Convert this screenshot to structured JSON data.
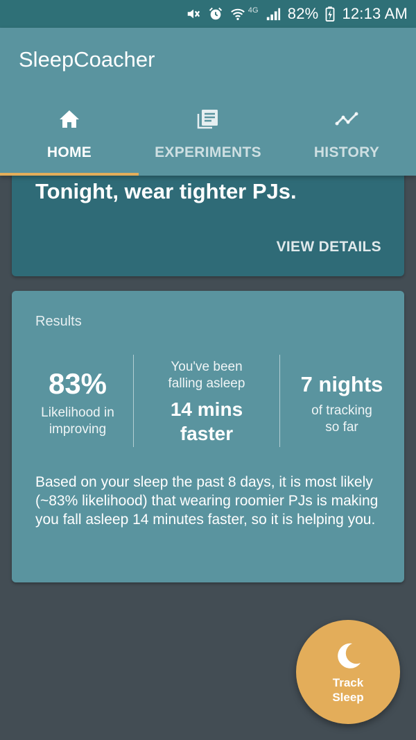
{
  "status_bar": {
    "battery": "82%",
    "time": "12:13 AM",
    "network": "4G"
  },
  "app": {
    "title": "SleepCoacher"
  },
  "tabs": [
    {
      "label": "HOME",
      "icon": "home-icon",
      "active": true
    },
    {
      "label": "EXPERIMENTS",
      "icon": "list-icon",
      "active": false
    },
    {
      "label": "HISTORY",
      "icon": "trend-icon",
      "active": false
    }
  ],
  "experiment_card": {
    "headline": "Tonight, wear tighter PJs.",
    "action_label": "VIEW DETAILS"
  },
  "results": {
    "title": "Results",
    "likelihood": {
      "value": "83%",
      "label_line1": "Likelihood in",
      "label_line2": "improving"
    },
    "effect": {
      "intro_line1": "You've been",
      "intro_line2": "falling asleep",
      "value_line1": "14 mins",
      "value_line2": "faster"
    },
    "tracking": {
      "value": "7 nights",
      "label_line1": "of tracking",
      "label_line2": "so far"
    },
    "summary": "Based on your sleep the past 8 days, it is most likely (~83% likelihood) that wearing roomier PJs is making you fall asleep 14 minutes faster, so it is helping you."
  },
  "fab": {
    "label_line1": "Track",
    "label_line2": "Sleep",
    "icon": "moon-icon"
  },
  "colors": {
    "background": "#434d54",
    "status_bar": "#2f7077",
    "app_bar": "#5a949f",
    "card_dark": "#2f6b77",
    "accent": "#e3ad5a"
  }
}
